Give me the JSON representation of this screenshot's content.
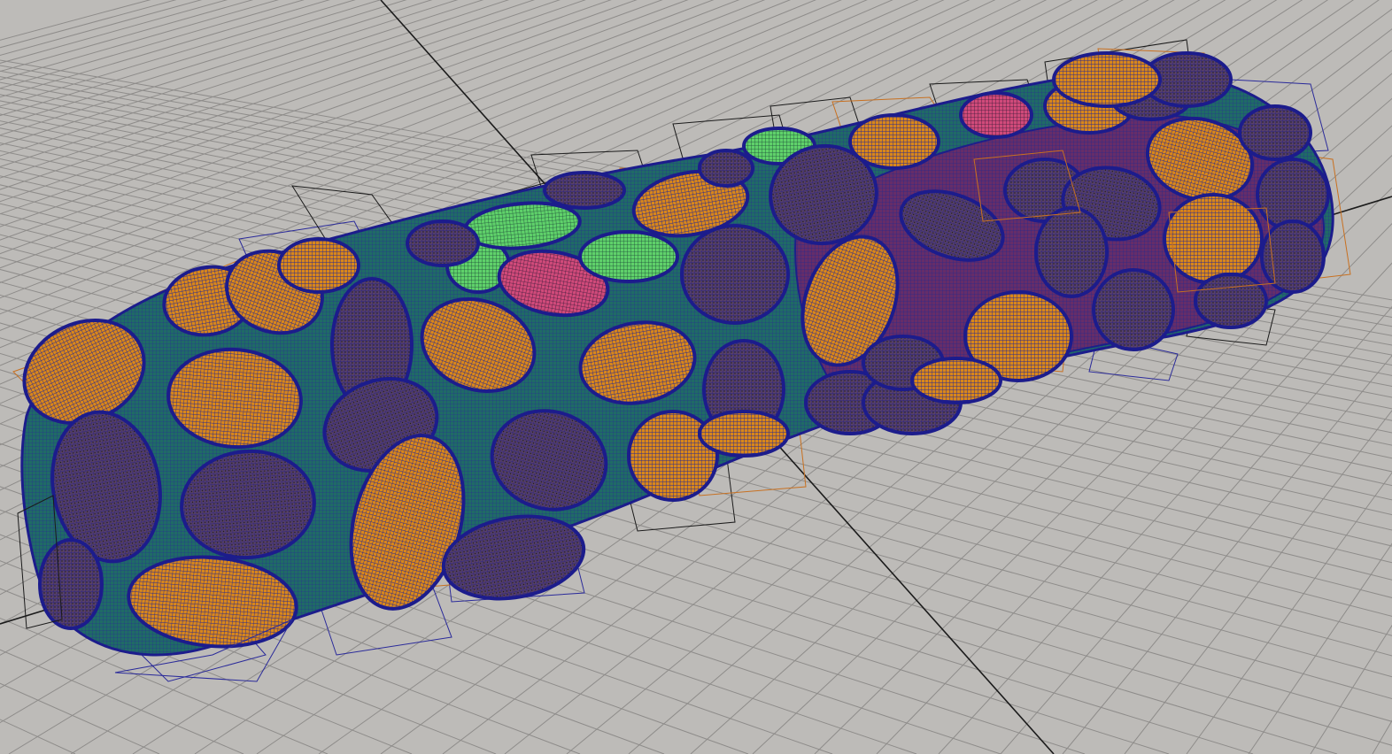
{
  "viewport": {
    "kind": "3d-perspective-viewport",
    "background": "#bdbbb8",
    "grid_color": "#8e8c8a",
    "axis_color": "#1b1b1b",
    "show_grid": true
  },
  "scene": {
    "object": "bean-cluster-mesh",
    "display_mode": "wireframe-on-shaded",
    "base_colors": [
      "#1f6b66",
      "#6a2a6a",
      "#2c2a8a"
    ],
    "bean_colors": {
      "dark": "#4a3a5a",
      "orange": "#d9871a",
      "green": "#5fd16a",
      "pink": "#d04a7a",
      "outline": "#1c1c8c"
    },
    "bounding_box_colors": [
      "#1a1a1a",
      "#c87020",
      "#2a2a9a"
    ]
  }
}
